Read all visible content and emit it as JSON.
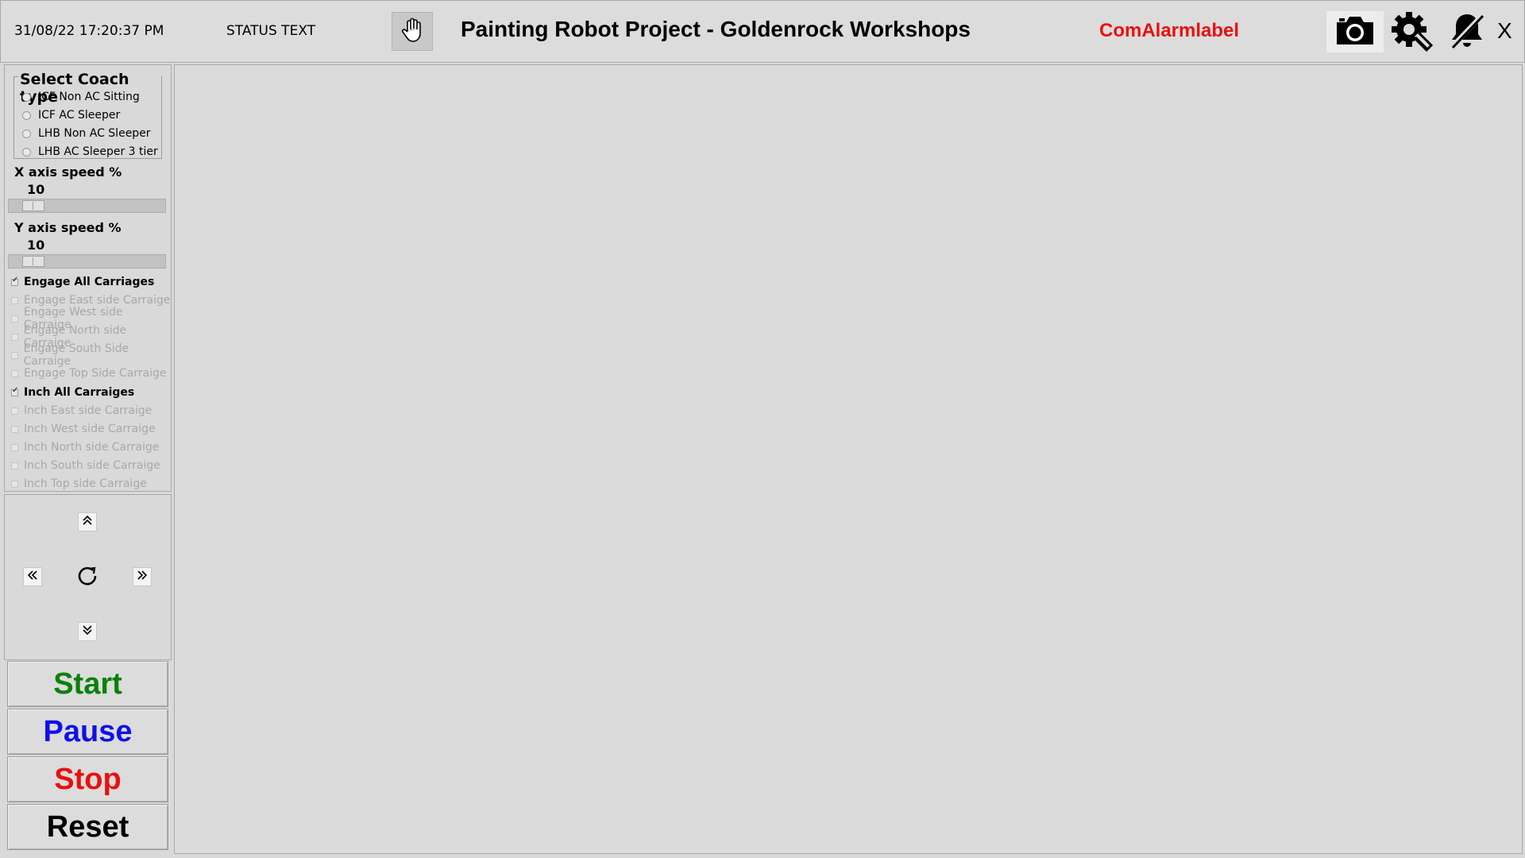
{
  "header": {
    "datetime": "31/08/22 17:20:37 PM",
    "status": "STATUS TEXT",
    "title": "Painting Robot Project - Goldenrock Workshops",
    "alarm_label": "ComAlarmlabel",
    "alarm_color": "#e81010",
    "close_label": "X",
    "icons": [
      "hand-icon",
      "camera-icon",
      "settings-gear-icon",
      "alarm-bell-muted-icon"
    ]
  },
  "coach": {
    "legend": "Select Coach type",
    "options": [
      "ICF Non AC Sitting",
      "ICF AC Sleeper",
      "LHB Non AC Sleeper",
      "LHB AC Sleeper 3 tier"
    ],
    "selected": null
  },
  "speed": {
    "x_label": "X axis speed %",
    "x_value": "10",
    "y_label": "Y axis speed %",
    "y_value": "10"
  },
  "carriages": {
    "engage_all": {
      "label": "Engage All Carriages",
      "checked": true
    },
    "engage_items": [
      {
        "label": "Engage East side Carraige",
        "checked": false
      },
      {
        "label": "Engage West side Carraige",
        "checked": false
      },
      {
        "label": "Engage North side Carraige",
        "checked": false
      },
      {
        "label": "Engage South Side Carraige",
        "checked": false
      },
      {
        "label": "Engage Top Side Carraige",
        "checked": false
      }
    ],
    "inch_all": {
      "label": "Inch All Carraiges",
      "checked": true
    },
    "inch_items": [
      {
        "label": "Inch East side Carraige",
        "checked": false
      },
      {
        "label": "Inch West side Carraige",
        "checked": false
      },
      {
        "label": "Inch North side Carraige",
        "checked": false
      },
      {
        "label": "Inch South side Carraige",
        "checked": false
      },
      {
        "label": "Inch Top side Carraige",
        "checked": false
      }
    ]
  },
  "jog": {
    "icons": [
      "chevron-up-icon",
      "chevron-left-icon",
      "home-rotate-icon",
      "chevron-right-icon",
      "chevron-down-icon"
    ]
  },
  "controls": {
    "start_label": "Start",
    "pause_label": "Pause",
    "stop_label": "Stop",
    "reset_label": "Reset",
    "start_color": "#0a800a",
    "pause_color": "#1010e8",
    "stop_color": "#e81010",
    "reset_color": "#000000"
  }
}
